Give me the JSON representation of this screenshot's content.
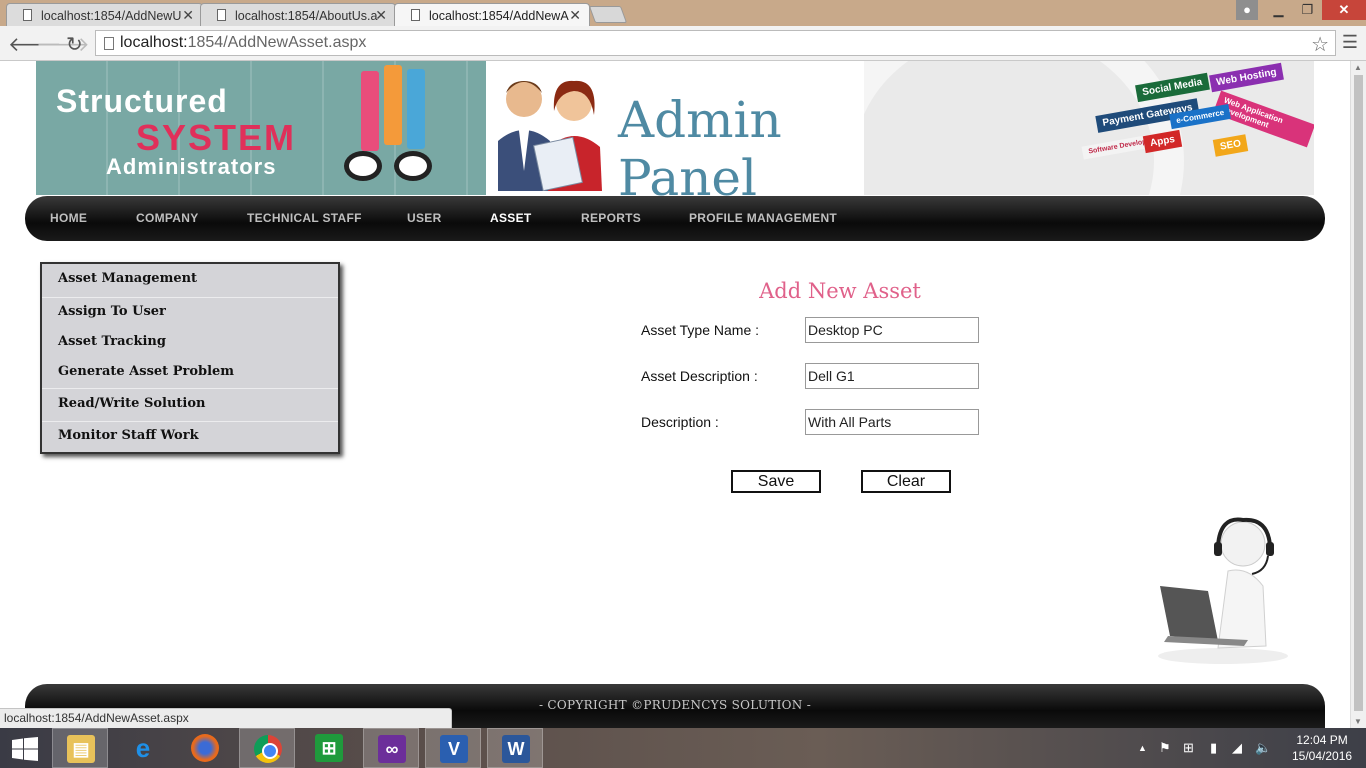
{
  "browser": {
    "tabs": [
      {
        "title": "localhost:1854/AddNewU"
      },
      {
        "title": "localhost:1854/AboutUs.a"
      },
      {
        "title": "localhost:1854/AddNewA"
      }
    ],
    "url_host": "localhost:",
    "url_path": "1854/AddNewAsset.aspx",
    "status_url": "localhost:1854/AddNewAsset.aspx"
  },
  "banner": {
    "line1": "Structured",
    "line2": "SYSTEM",
    "line3": "Administrators",
    "admin_title": "Admin Panel",
    "signs": [
      "Social Media",
      "Web Hosting",
      "Payment Gateways",
      "Web Application Development",
      "e-Commerce",
      "Software Development",
      "Apps",
      "SEO"
    ]
  },
  "nav": {
    "items": [
      "HOME",
      "COMPANY",
      "TECHNICAL STAFF",
      "USER",
      "ASSET",
      "REPORTS",
      "PROFILE MANAGEMENT"
    ],
    "active": "ASSET"
  },
  "sidemenu": {
    "items": [
      "Asset Management",
      "Assign To User",
      "Asset Tracking",
      "Generate Asset Problem",
      "Read/Write Solution",
      "Monitor Staff Work"
    ]
  },
  "form": {
    "title": "Add New Asset",
    "fields": [
      {
        "label": "Asset Type Name :",
        "value": "Desktop PC"
      },
      {
        "label": "Asset Description :",
        "value": "Dell G1"
      },
      {
        "label": "Description :",
        "value": "With All Parts"
      }
    ],
    "save_label": "Save",
    "clear_label": "Clear"
  },
  "footer": {
    "copyright": "- COPYRIGHT ©PRUDENCYS SOLUTION -"
  },
  "taskbar": {
    "time": "12:04 PM",
    "date": "15/04/2016",
    "apps": [
      "file-explorer",
      "internet-explorer",
      "firefox",
      "chrome",
      "store",
      "visual-studio",
      "visio",
      "word"
    ]
  }
}
